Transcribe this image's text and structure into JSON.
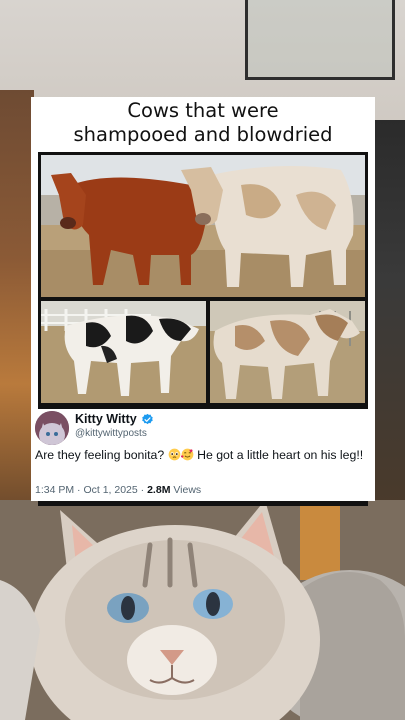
{
  "post": {
    "title_line1": "Cows that were",
    "title_line2": "shampooed and blowdried"
  },
  "tweet": {
    "display_name": "Kitty Witty",
    "handle": "@kittywittyposts",
    "text_part1": "Are they feeling bonita?",
    "text_part2": "He got a little heart on his leg!!",
    "time": "1:34 PM",
    "separator": "·",
    "date": "Oct 1, 2025",
    "views_count": "2.8M",
    "views_label": "Views"
  },
  "icons": {
    "verified": "verified-badge-icon",
    "emoji1": "pleading-face-emoji",
    "emoji2": "smiling-face-with-hearts-emoji"
  },
  "colors": {
    "verified_blue": "#1d9bf0",
    "text_primary": "#0f1419",
    "text_secondary": "#536471"
  }
}
